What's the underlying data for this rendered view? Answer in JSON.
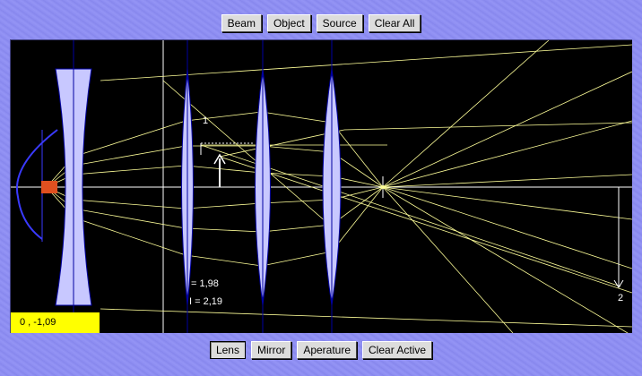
{
  "top_toolbar": {
    "beam_label": "Beam",
    "object_label": "Object",
    "source_label": "Source",
    "clear_all_label": "Clear All"
  },
  "bottom_toolbar": {
    "lens_label": "Lens",
    "mirror_label": "Mirror",
    "aperture_label": "Aperature",
    "clear_active_label": "Clear Active"
  },
  "canvas": {
    "coordinate_readout": "0 , -1,09",
    "object_label": "1",
    "image_label": "2",
    "measure_1": "= 1,98",
    "measure_2": "I = 2,19"
  },
  "colors": {
    "frame": "#8d8df2",
    "canvas_bg": "#000000",
    "lens_fill": "#c8c8ff",
    "ray": "#ffff99",
    "readout_bg": "#ffff00",
    "axis": "#ffffff",
    "mirror": "#3a3aff"
  }
}
